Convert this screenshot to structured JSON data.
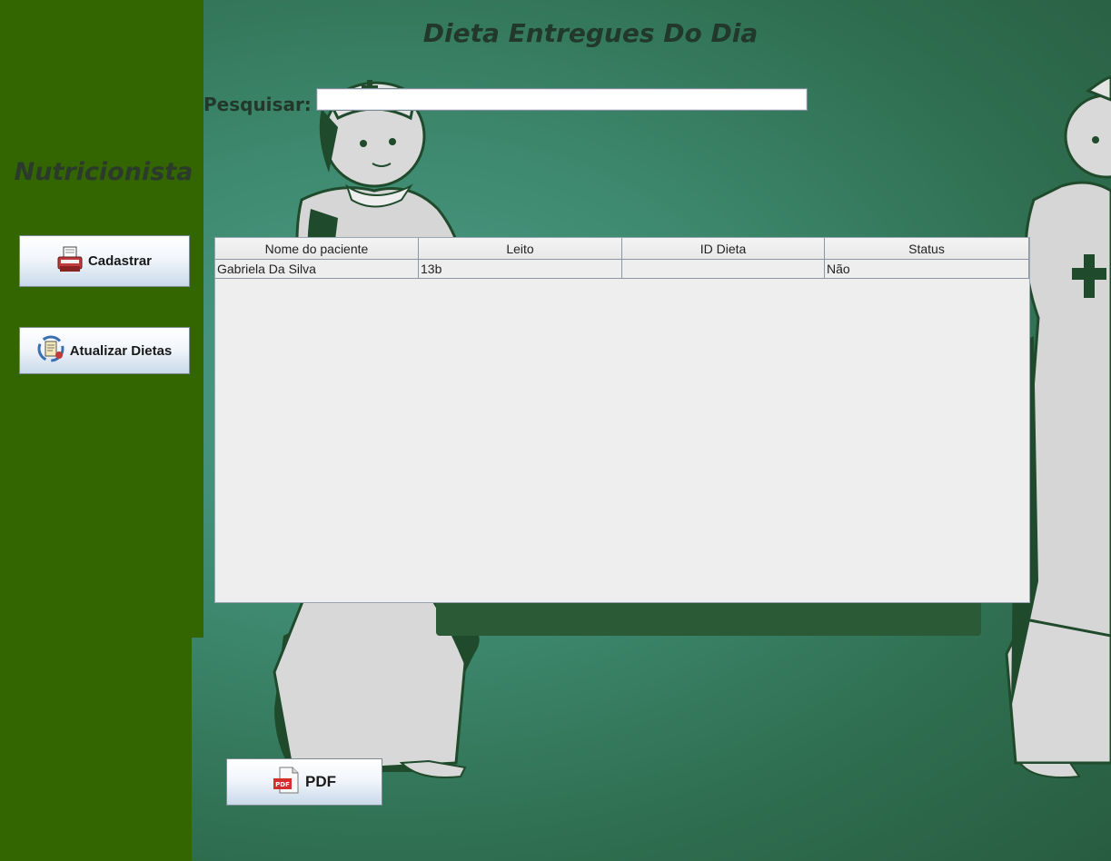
{
  "header": {
    "title": "Dieta Entregues Do Dia"
  },
  "sidebar": {
    "role_title": "Nutricionista",
    "buttons": [
      {
        "label": "Cadastrar",
        "icon": "register-printer-icon"
      },
      {
        "label": "Atualizar Dietas",
        "icon": "update-document-icon"
      }
    ]
  },
  "search": {
    "label": "Pesquisar:",
    "value": "",
    "placeholder": ""
  },
  "table": {
    "columns": [
      "Nome do paciente",
      "Leito",
      "ID Dieta",
      "Status"
    ],
    "rows": [
      {
        "nome": "Gabriela Da Silva",
        "leito": "13b",
        "id_dieta": "",
        "status": "Não"
      }
    ]
  },
  "footer": {
    "pdf_label": "PDF",
    "pdf_icon": "pdf-file-icon"
  },
  "colors": {
    "sidebar": "#336600",
    "background": "#3e8a70",
    "title_text": "#22382a"
  }
}
